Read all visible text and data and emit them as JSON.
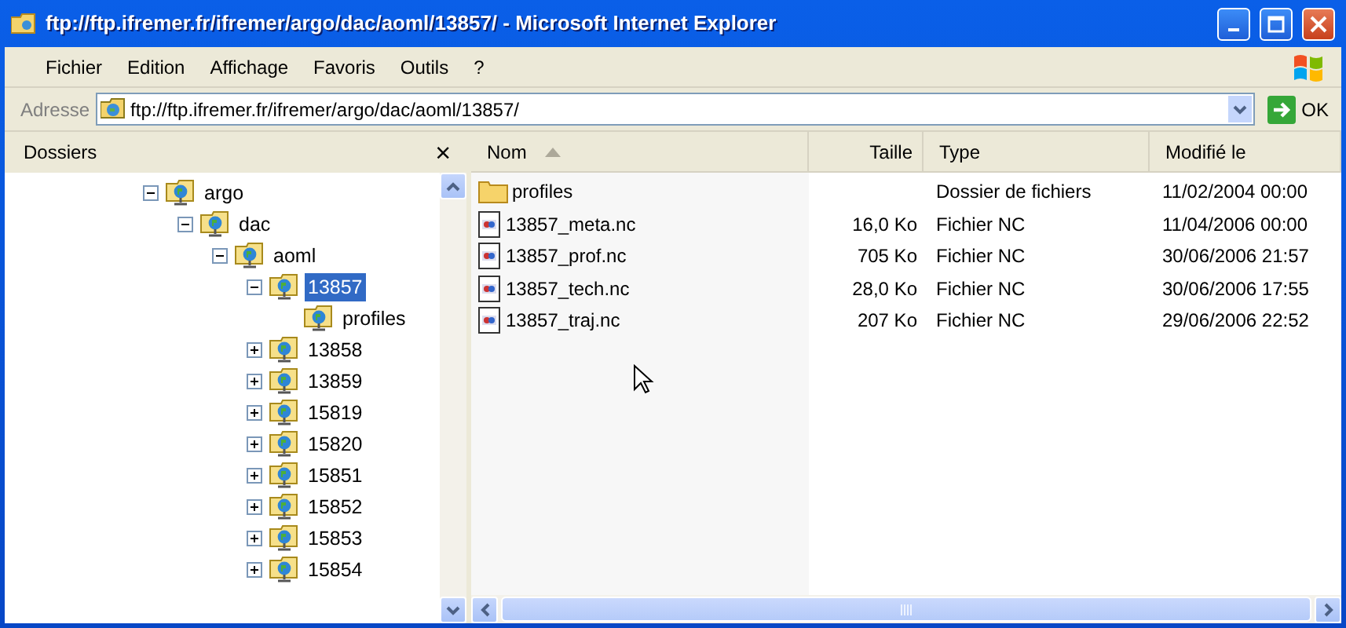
{
  "window": {
    "title": "ftp://ftp.ifremer.fr/ifremer/argo/dac/aoml/13857/ - Microsoft Internet Explorer"
  },
  "menu": [
    "Fichier",
    "Edition",
    "Affichage",
    "Favoris",
    "Outils",
    "?"
  ],
  "address_bar": {
    "label": "Adresse",
    "value": "ftp://ftp.ifremer.fr/ifremer/argo/dac/aoml/13857/",
    "go": "OK"
  },
  "folders_pane": {
    "title": "Dossiers",
    "close": "×",
    "tree": [
      {
        "label": "argo",
        "expanded": true,
        "selected": false,
        "children": [
          {
            "label": "dac",
            "expanded": true,
            "selected": false,
            "children": [
              {
                "label": "aoml",
                "expanded": true,
                "selected": false,
                "children": [
                  {
                    "label": "13857",
                    "expanded": true,
                    "selected": true,
                    "children": [
                      {
                        "label": "profiles",
                        "selected": false
                      }
                    ]
                  },
                  {
                    "label": "13858",
                    "expanded": false,
                    "selected": false
                  },
                  {
                    "label": "13859",
                    "expanded": false,
                    "selected": false
                  },
                  {
                    "label": "15819",
                    "expanded": false,
                    "selected": false
                  },
                  {
                    "label": "15820",
                    "expanded": false,
                    "selected": false
                  },
                  {
                    "label": "15851",
                    "expanded": false,
                    "selected": false
                  },
                  {
                    "label": "15852",
                    "expanded": false,
                    "selected": false
                  },
                  {
                    "label": "15853",
                    "expanded": false,
                    "selected": false
                  },
                  {
                    "label": "15854",
                    "expanded": false,
                    "selected": false
                  }
                ]
              }
            ]
          }
        ]
      }
    ]
  },
  "file_list": {
    "columns": [
      {
        "label": "Nom",
        "sorted": true
      },
      {
        "label": "Taille",
        "sorted": false
      },
      {
        "label": "Type",
        "sorted": false
      },
      {
        "label": "Modifié le",
        "sorted": false
      }
    ],
    "rows": [
      {
        "kind": "folder",
        "name": "profiles",
        "size": "",
        "type": "Dossier de fichiers",
        "modified": "11/02/2004 00:00"
      },
      {
        "kind": "file",
        "name": "13857_meta.nc",
        "size": "16,0 Ko",
        "type": "Fichier NC",
        "modified": "11/04/2006 00:00"
      },
      {
        "kind": "file",
        "name": "13857_prof.nc",
        "size": "705 Ko",
        "type": "Fichier NC",
        "modified": "30/06/2006 21:57"
      },
      {
        "kind": "file",
        "name": "13857_tech.nc",
        "size": "28,0 Ko",
        "type": "Fichier NC",
        "modified": "30/06/2006 17:55"
      },
      {
        "kind": "file",
        "name": "13857_traj.nc",
        "size": "207 Ko",
        "type": "Fichier NC",
        "modified": "29/06/2006 22:52"
      }
    ]
  }
}
